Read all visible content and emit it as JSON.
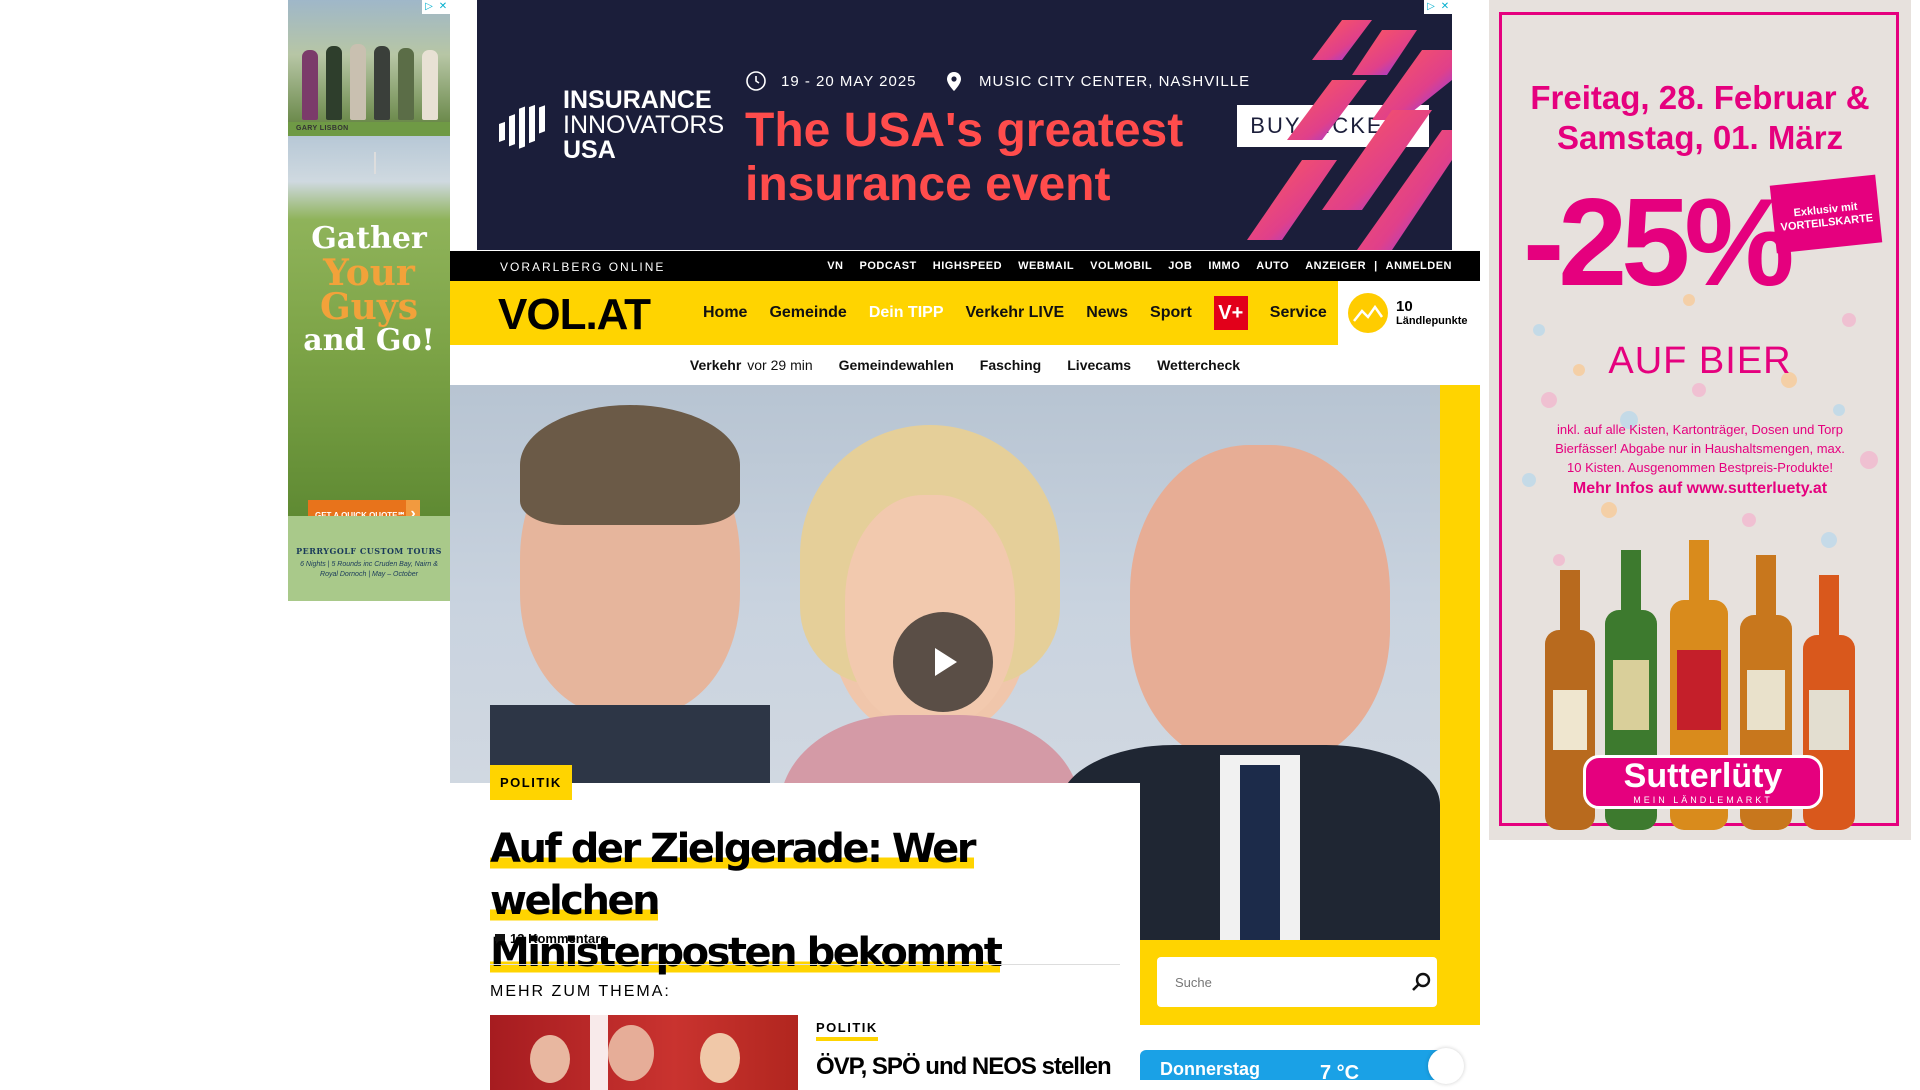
{
  "ads": {
    "left": {
      "caption": "GARY LISBON",
      "headline": [
        "Gather",
        "Your",
        "Guys",
        "and Go!"
      ],
      "cta": "GET A QUICK QUOTE℠",
      "footer_title": "PERRYGOLF CUSTOM TOURS",
      "footer_text": "6 Nights | 5 Rounds inc Cruden Bay, Nairn & Royal Dornoch | May – October"
    },
    "top": {
      "logo_line1": "INSURANCE",
      "logo_line2": "INNOVATORS",
      "logo_line3": "USA",
      "date": "19 - 20 MAY 2025",
      "venue": "MUSIC CITY CENTER, NASHVILLE",
      "headline": "The USA's greatest insurance event",
      "cta": "BUY TICKETS",
      "accent": "#ff4c4c"
    },
    "right": {
      "dates": "Freitag, 28. Februar & Samstag, 01. März",
      "discount": "-25%",
      "badge": "Exklusiv mit VORTEILSKARTE",
      "product": "AUF BIER",
      "fine_print": "inkl. auf alle Kisten, Kartonträger, Dosen und Torp Bierfässer! Abgabe nur in Haushaltsmengen, max. 10 Kisten. Ausgenommen Bestpreis-Produkte!",
      "infos": "Mehr Infos auf www.sutterluety.at",
      "brand": "Sutterlüty",
      "brand_sub": "MEIN LÄNDLEMARKT",
      "accent": "#e5007e"
    }
  },
  "topbar": {
    "brand": "VORARLBERG ONLINE",
    "links": [
      "VN",
      "PODCAST",
      "HIGHSPEED",
      "WEBMAIL",
      "VOLMOBIL",
      "JOB",
      "IMMO",
      "AUTO",
      "ANZEIGER",
      "|",
      "ANMELDEN"
    ]
  },
  "nav": {
    "logo": "VOL.AT",
    "items": [
      "Home",
      "Gemeinde",
      "Dein TIPP",
      "Verkehr LIVE",
      "News",
      "Sport"
    ],
    "vplus": "V+",
    "service": "Service",
    "points_value": "10",
    "points_label": "Ländlepunkte",
    "accent": "#ffd400"
  },
  "subnav": {
    "verkehr": "Verkehr",
    "verkehr_time": "vor 29 min",
    "items": [
      "Gemeindewahlen",
      "Fasching",
      "Livecams",
      "Wettercheck"
    ]
  },
  "article": {
    "category": "POLITIK",
    "title_line1": "Auf der Zielgerade: Wer welchen",
    "title_line2": "Ministerposten bekommt",
    "comments": "13 Kommentare",
    "more_label": "MEHR ZUM THEMA:",
    "related_category": "POLITIK",
    "related_title": "ÖVP, SPÖ und NEOS stellen"
  },
  "search": {
    "placeholder": "Suche"
  },
  "weather": {
    "day": "Donnerstag",
    "temp": "7 °C"
  }
}
